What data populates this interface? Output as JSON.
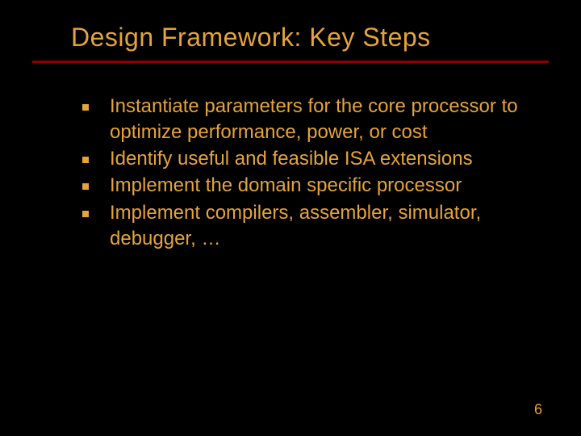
{
  "title": "Design Framework: Key Steps",
  "bullets": {
    "b0": "Instantiate parameters for the core processor to optimize performance, power, or cost",
    "b1": "Identify useful and feasible ISA extensions",
    "b2": "Implement the domain specific processor",
    "b3": "Implement compilers, assembler, simulator, debugger, …"
  },
  "page_number": "6"
}
